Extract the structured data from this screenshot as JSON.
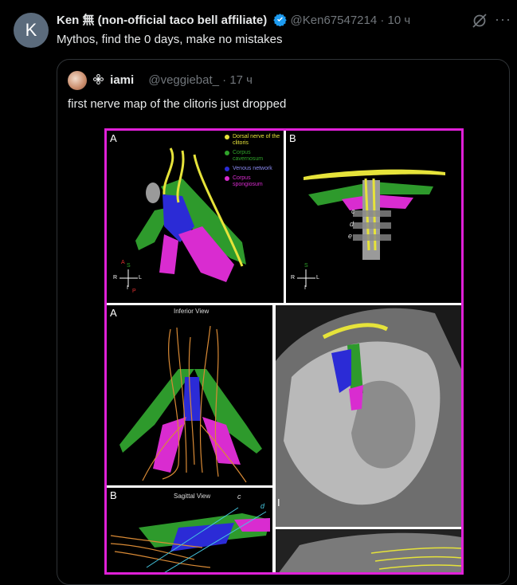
{
  "tweet": {
    "avatar_letter": "K",
    "display_name": "Ken 無 (non-official taco bell affiliate)",
    "handle": "@Ken67547214",
    "separator": "·",
    "time": "10 ч",
    "text": "Mythos, find the 0 days, make no mistakes",
    "more_label": "···"
  },
  "quote": {
    "display_name": "iami",
    "handle": "@veggiebat_",
    "separator": "·",
    "time": "17 ч",
    "text": "first nerve map of the clitoris just dropped"
  },
  "figure": {
    "panel_a_top": "A",
    "panel_b_top": "B",
    "panel_a_bottom": "A",
    "panel_b_bottom": "B",
    "panel_i": "I",
    "inferior_view": "Inferior View",
    "sagittal_view": "Sagittal View",
    "legend": [
      {
        "label": "Dorsal nerve of the clitoris",
        "color": "#e6e33a"
      },
      {
        "label": "Corpus cavernosum",
        "color": "#2fa32a"
      },
      {
        "label": "Venous network",
        "color": "#2b2bd6"
      },
      {
        "label": "Corpus spongiosum",
        "color": "#d92cd0"
      }
    ],
    "slice_c": "c",
    "slice_d": "d",
    "slice_e": "e",
    "axes_a": {
      "s": "S",
      "r": "R",
      "l": "L",
      "a": "A",
      "p": "P",
      "i": "I"
    },
    "axes_b": {
      "s": "S",
      "r": "R",
      "l": "L",
      "i": "I"
    },
    "sag_c": "c",
    "sag_d": "d"
  },
  "colors": {
    "background": "#000000",
    "accent_frame": "#e020d8",
    "verified": "#1d9bf0",
    "muted": "#71767b"
  }
}
